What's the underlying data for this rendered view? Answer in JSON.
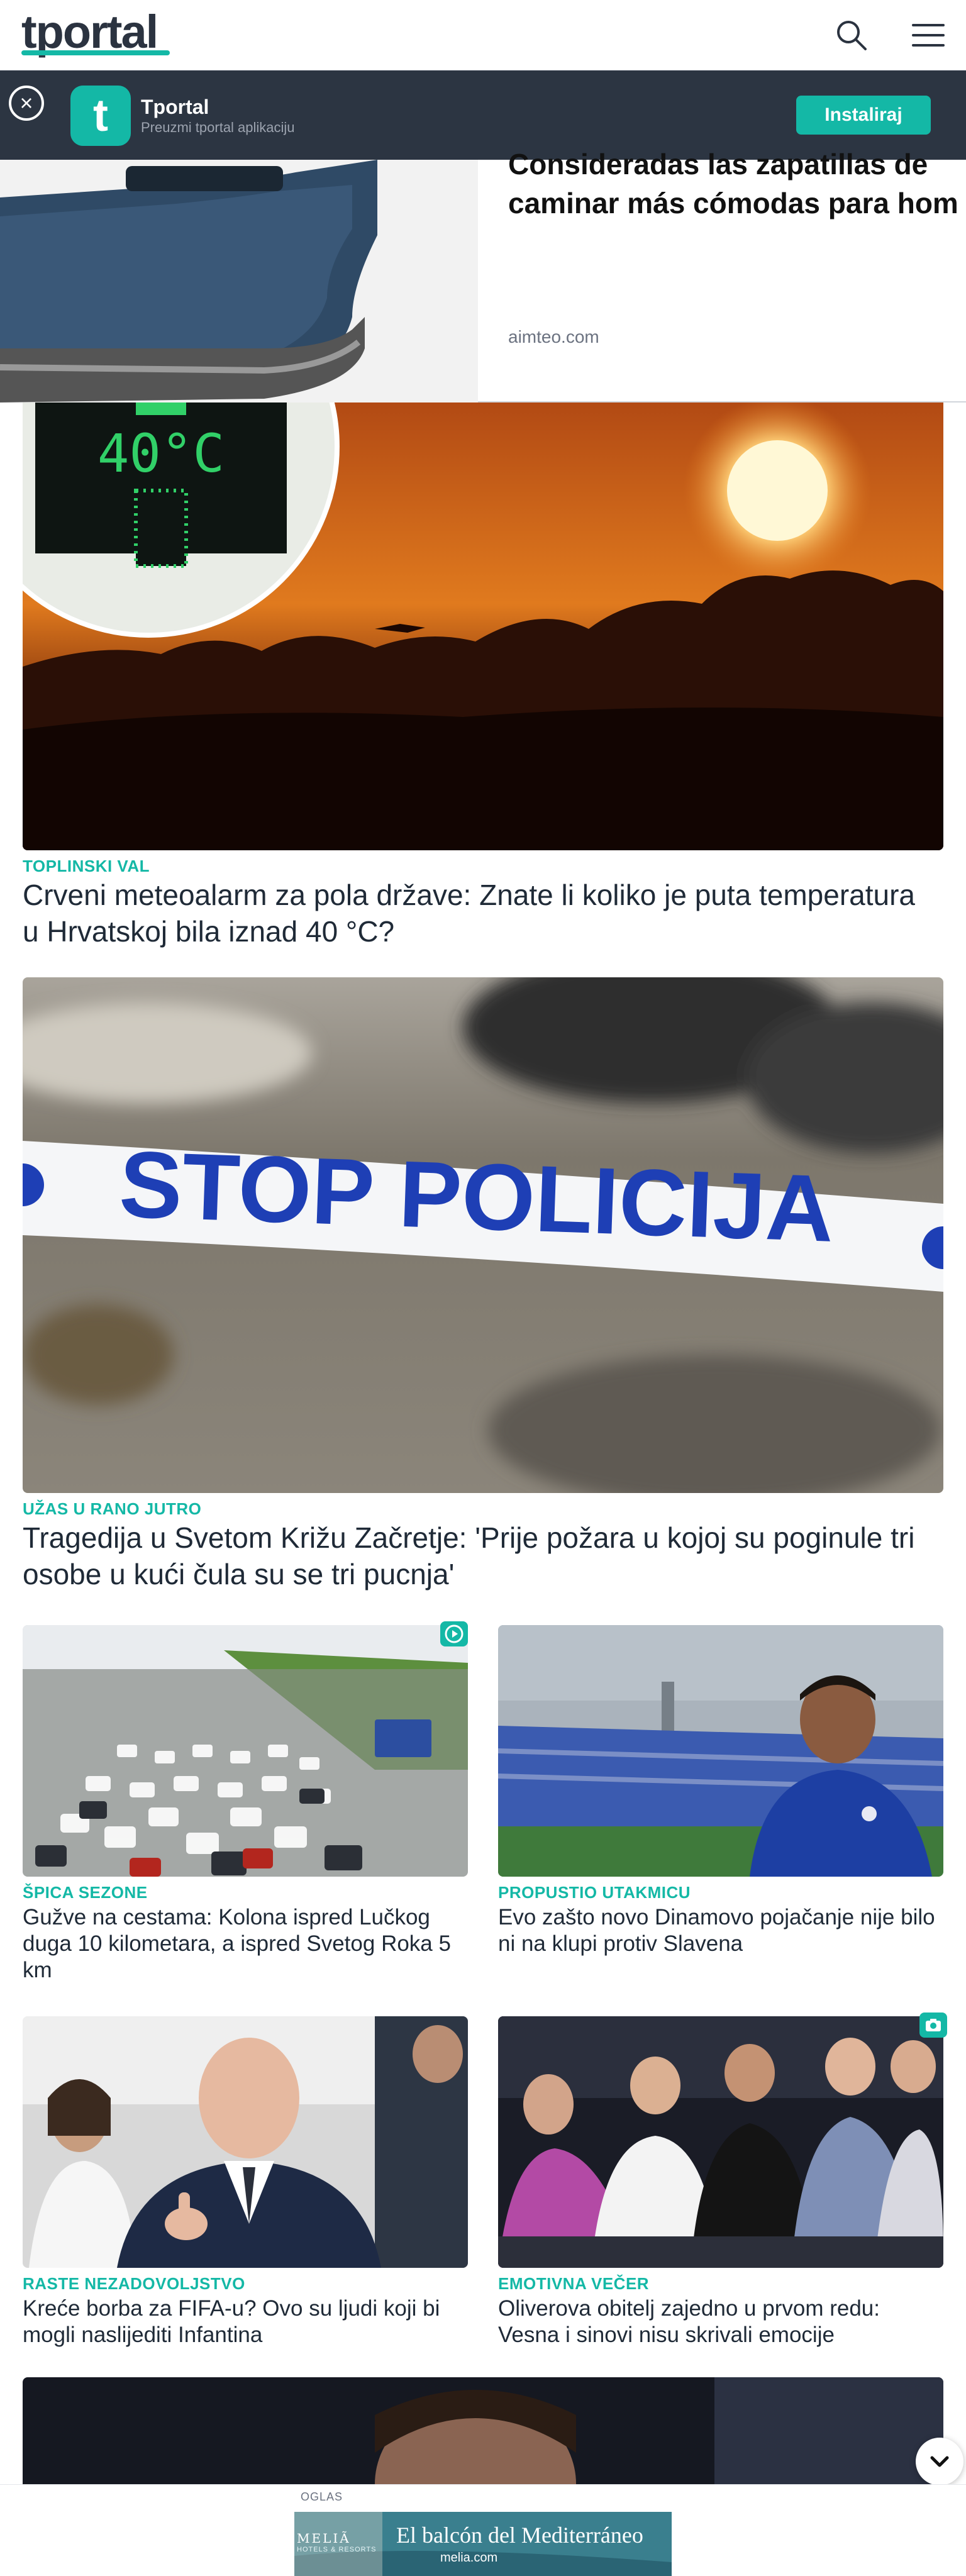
{
  "header": {
    "logo": "tportal"
  },
  "app_banner": {
    "app_name": "Tportal",
    "app_subtitle": "Preuzmi tportal aplikaciju",
    "install_label": "Instaliraj",
    "icon_letter": "t"
  },
  "ad_top": {
    "title_line1": "Consideradas las zapatillas de",
    "title_line2": "caminar más cómodas para hom",
    "domain": "aimteo.com"
  },
  "thermo": "40°C",
  "articles": [
    {
      "kicker": "TOPLINSKI VAL",
      "title": "Crveni meteoalarm za pola države: Znate li koliko je puta temperatura u Hrvatskoj bila iznad 40 °C?"
    },
    {
      "kicker": "UŽAS U RANO JUTRO",
      "title": "Tragedija u Svetom Križu Začretje: 'Prije požara u kojoj su poginule tri osobe u kući čula su se tri pucnja'"
    },
    {
      "kicker": "ŠPICA SEZONE",
      "title": "Gužve na cestama: Kolona ispred Lučkog duga 10 kilometara, a ispred Svetog Roka 5 km"
    },
    {
      "kicker": "PROPUSTIO UTAKMICU",
      "title": "Evo zašto novo Dinamovo pojačanje nije bilo ni na klupi protiv Slavena"
    },
    {
      "kicker": "RASTE NEZADOVOLJSTVO",
      "title": "Kreće borba za FIFA-u? Ovo su ljudi koji bi mogli naslijediti Infantina"
    },
    {
      "kicker": "EMOTIVNA VEČER",
      "title": "Oliverova obitelj zajedno u prvom redu: Vesna i sinovi nisu skrivali emocije"
    }
  ],
  "police_tape": "STOP POLICIJA",
  "ad_bottom": {
    "label": "OGLAS",
    "brand": "MELIÃ",
    "brand_sub": "HOTELS & RESORTS",
    "headline": "El balcón del Mediterráneo",
    "url": "melia.com"
  },
  "colors": {
    "accent": "#14b8a6",
    "dark": "#2c3542"
  }
}
